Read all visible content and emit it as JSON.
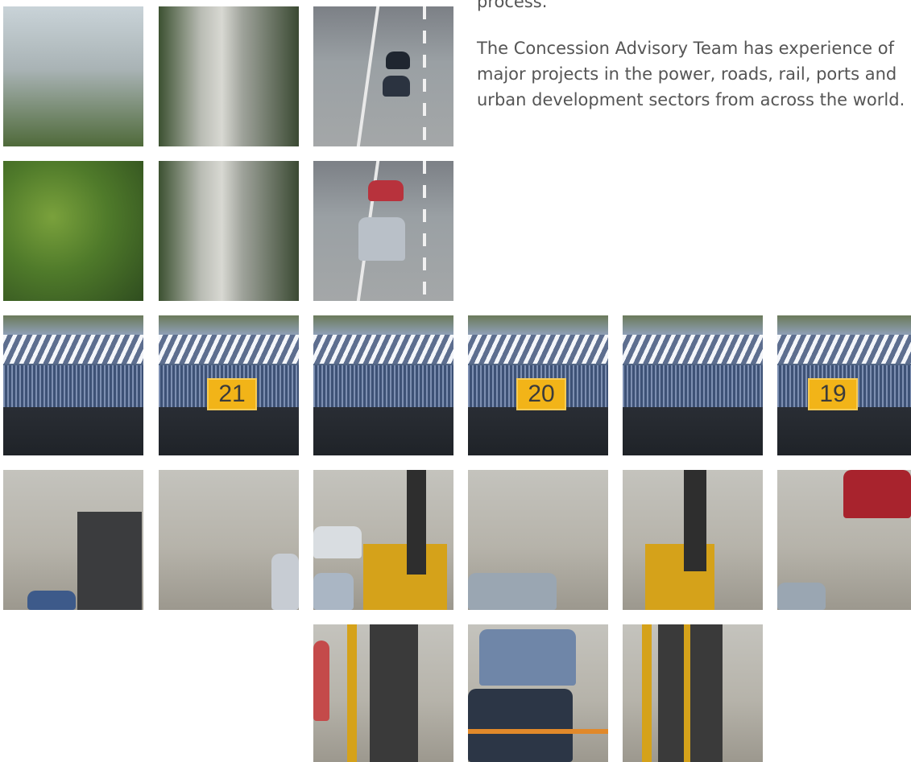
{
  "text": {
    "line_process": "process.",
    "paragraph": "The Concession Advisory Team has experience of major projects in the power, roads, rail, ports and urban development sectors from across the world."
  },
  "gantry_numbers": [
    "21",
    "20",
    "19"
  ],
  "colors": {
    "text": "#555555",
    "sign_yellow": "#f2b418"
  }
}
